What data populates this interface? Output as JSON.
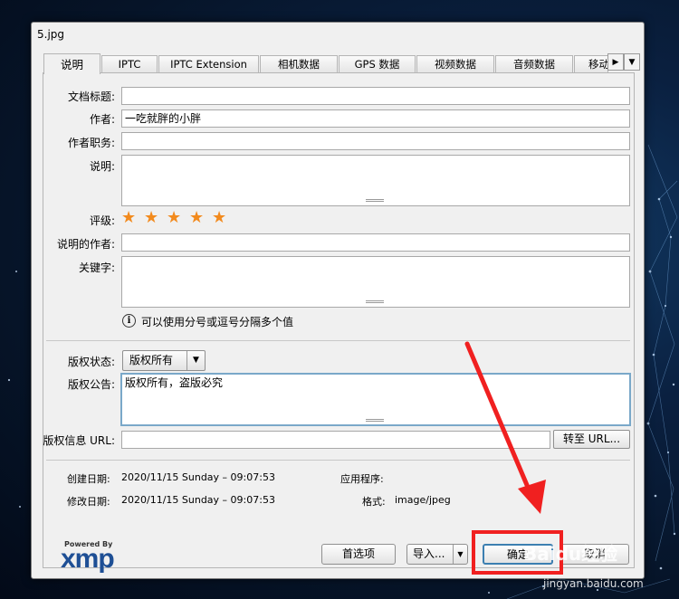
{
  "window": {
    "title": "5.jpg"
  },
  "tabs": [
    "说明",
    "IPTC",
    "IPTC Extension",
    "相机数据",
    "GPS 数据",
    "视频数据",
    "音频数据",
    "移动"
  ],
  "form": {
    "doc_title_label": "文档标题:",
    "doc_title_value": "",
    "author_label": "作者:",
    "author_value": "一吃就胖的小胖",
    "author_title_label": "作者职务:",
    "author_title_value": "",
    "description_label": "说明:",
    "description_value": "",
    "rating_label": "评级:",
    "rating": 5,
    "desc_writer_label": "说明的作者:",
    "desc_writer_value": "",
    "keywords_label": "关键字:",
    "keywords_value": "",
    "hint_text": "可以使用分号或逗号分隔多个值",
    "copyright_status_label": "版权状态:",
    "copyright_status_value": "版权所有",
    "copyright_notice_label": "版权公告:",
    "copyright_notice_value": "版权所有，盗版必究",
    "copyright_url_label": "版权信息 URL:",
    "copyright_url_value": "",
    "goto_url_button": "转至 URL..."
  },
  "meta": {
    "created_label": "创建日期:",
    "created_value": "2020/11/15 Sunday – 09:07:53",
    "modified_label": "修改日期:",
    "modified_value": "2020/11/15 Sunday – 09:07:53",
    "app_label": "应用程序:",
    "app_value": "",
    "format_label": "格式:",
    "format_value": "image/jpeg"
  },
  "footer": {
    "powered_by": "Powered By",
    "xmp_logo": "xmp",
    "preferences_button": "首选项",
    "import_button": "导入...",
    "ok_button": "确定",
    "cancel_button": "取消"
  },
  "watermark": {
    "brand": "Baidu经验",
    "url": "jingyan.baidu.com"
  },
  "colors": {
    "star": "#f28a1d",
    "annotation": "#f02020",
    "focus": "#7aa8c9",
    "xmp_blue": "#1e4f95"
  }
}
